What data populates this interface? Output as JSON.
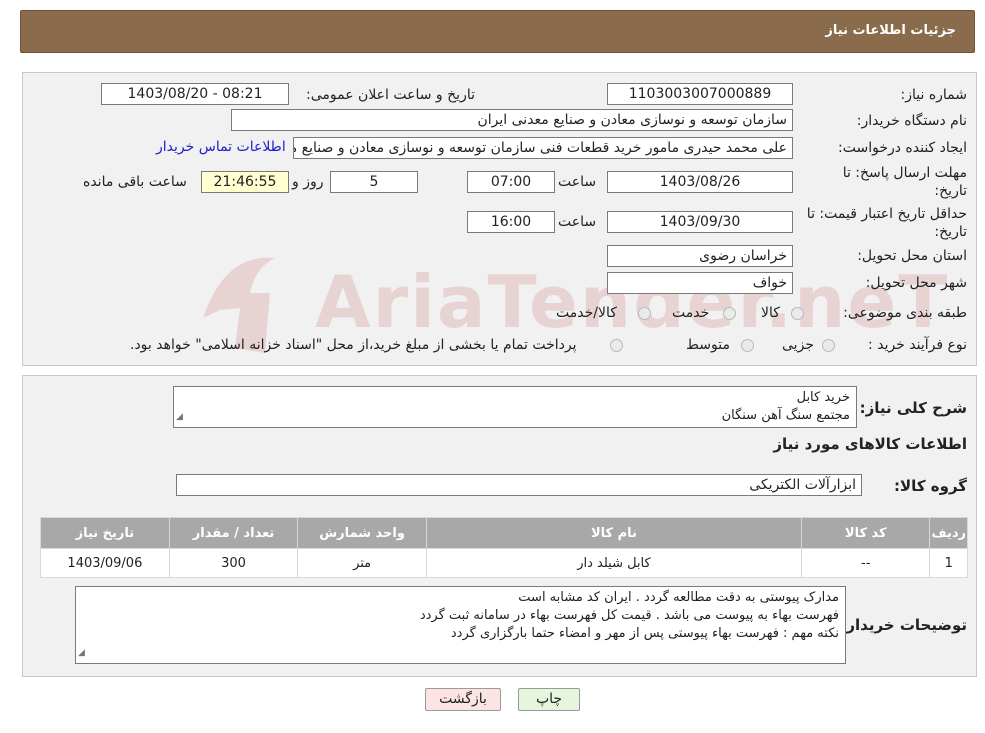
{
  "header": {
    "title": "جزئیات اطلاعات نیاز"
  },
  "watermark": {
    "text": "AriaTender.neT"
  },
  "form": {
    "need_number_label": "شماره نیاز:",
    "need_number": "1103003007000889",
    "announce_label": "تاریخ و ساعت اعلان عمومی:",
    "announce_value": "1403/08/20 - 08:21",
    "buyer_org_label": "نام دستگاه خریدار:",
    "buyer_org": "سازمان توسعه و نوسازی معادن و صنایع معدنی ایران",
    "requester_label": "ایجاد کننده درخواست:",
    "requester": "علی محمد حیدری مامور خرید قطعات فنی سازمان توسعه و نوسازی معادن و صنایع معدنی ایران",
    "contact_link": "اطلاعات تماس خریدار",
    "reply_deadline_label_1": "مهلت ارسال پاسخ: تا",
    "reply_deadline_label_2": "تاریخ:",
    "reply_date": "1403/08/26",
    "time_label": "ساعت",
    "reply_time": "07:00",
    "days_value": "5",
    "days_label": "روز و",
    "remaining_time": "21:46:55",
    "remaining_label": "ساعت باقی مانده",
    "validity_label_1": "حداقل تاریخ اعتبار قیمت: تا",
    "validity_label_2": "تاریخ:",
    "validity_date": "1403/09/30",
    "validity_time": "16:00",
    "province_label": "استان محل تحویل:",
    "province": "خراسان رضوی",
    "city_label": "شهر محل تحویل:",
    "city": "خواف",
    "category_label": "طبقه بندی موضوعی:",
    "category_options": [
      "کالا",
      "خدمت",
      "کالا/خدمت"
    ],
    "process_label": "نوع فرآیند خرید :",
    "process_options": [
      "جزیی",
      "متوسط"
    ],
    "process_note": "پرداخت تمام یا بخشی از مبلغ خرید،از محل \"اسناد خزانه اسلامی\" خواهد بود."
  },
  "summary": {
    "label": "شرح کلی نیاز:",
    "line1": "خرید کابل",
    "line2": "مجتمع سنگ آهن سنگان",
    "items_heading": "اطلاعات کالاهای مورد نیاز",
    "group_label": "گروه کالا:",
    "group_value": "ابزارآلات الکتریکی"
  },
  "table": {
    "headers": [
      "ردیف",
      "کد کالا",
      "نام کالا",
      "واحد شمارش",
      "تعداد / مقدار",
      "تاریخ نیاز"
    ],
    "rows": [
      [
        "1",
        "--",
        "کابل شیلد دار",
        "متر",
        "300",
        "1403/09/06"
      ]
    ]
  },
  "notes": {
    "label": "توضیحات خریدار:",
    "line1": "مدارک پیوستی به دقت مطالعه گردد . ایران کد مشابه است",
    "line2": "فهرست بهاء به پیوست می باشد . قیمت کل فهرست بهاء در سامانه ثبت گردد",
    "line3": "نکته مهم : فهرست بهاء پیوستی پس از مهر و امضاء حتما بارگزاری گردد"
  },
  "buttons": {
    "print": "چاپ",
    "back": "بازگشت"
  },
  "colors": {
    "header_bg": "#8a6c4c",
    "back_button_bg": "#fce4e4",
    "print_button_bg": "#e6f6dc",
    "link": "#2020cc"
  }
}
